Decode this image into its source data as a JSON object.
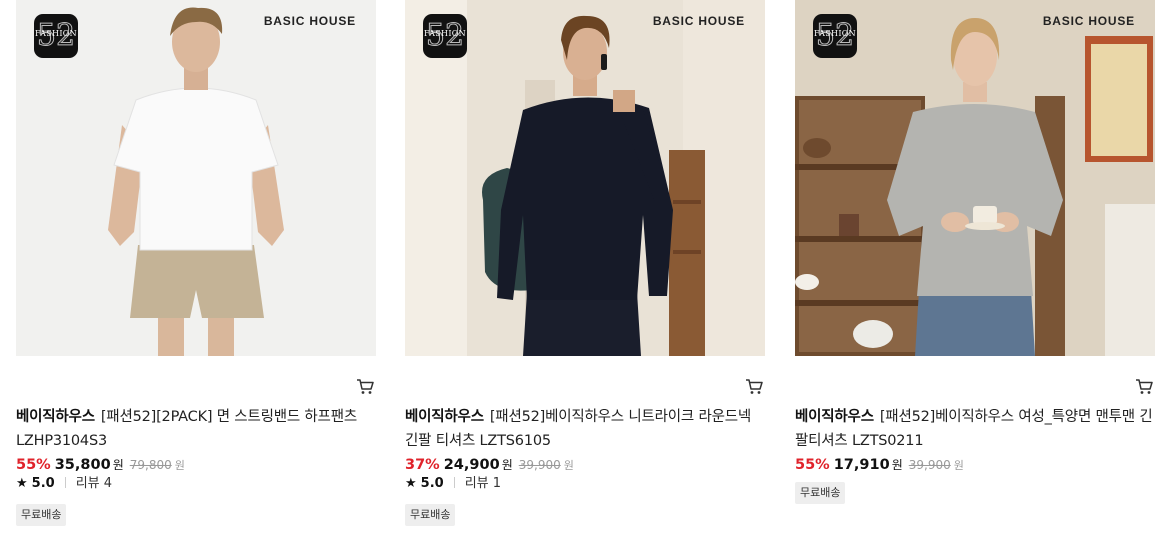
{
  "colors": {
    "discount": "#e0232b",
    "strikethrough": "#999999",
    "tag_bg": "#eeeeee"
  },
  "products": [
    {
      "badge": {
        "text": "FASHION",
        "number": "52"
      },
      "brand_logo": "BASIC HOUSE",
      "cart_icon": "cart-icon",
      "brand": "베이직하우스",
      "name": "[패션52][2PACK] 면 스트링밴드 하프팬츠 LZHP3104S3",
      "discount": "55%",
      "price": "35,800",
      "price_unit": "원",
      "original_price": "79,800",
      "original_unit": "원",
      "star_icon": "★",
      "rating": "5.0",
      "review": "리뷰 4",
      "shipping": "무료배송"
    },
    {
      "badge": {
        "text": "FASHION",
        "number": "52"
      },
      "brand_logo": "BASIC HOUSE",
      "cart_icon": "cart-icon",
      "brand": "베이직하우스",
      "name": "[패션52]베이직하우스 니트라이크 라운드넥 긴팔 티셔츠 LZTS6105",
      "discount": "37%",
      "price": "24,900",
      "price_unit": "원",
      "original_price": "39,900",
      "original_unit": "원",
      "star_icon": "★",
      "rating": "5.0",
      "review": "리뷰 1",
      "shipping": "무료배송"
    },
    {
      "badge": {
        "text": "FASHION",
        "number": "52"
      },
      "brand_logo": "BASIC HOUSE",
      "cart_icon": "cart-icon",
      "brand": "베이직하우스",
      "name": "[패션52]베이직하우스 여성_특양면 맨투맨 긴팔티셔츠 LZTS0211",
      "discount": "55%",
      "price": "17,910",
      "price_unit": "원",
      "original_price": "39,900",
      "original_unit": "원",
      "shipping": "무료배송"
    }
  ]
}
